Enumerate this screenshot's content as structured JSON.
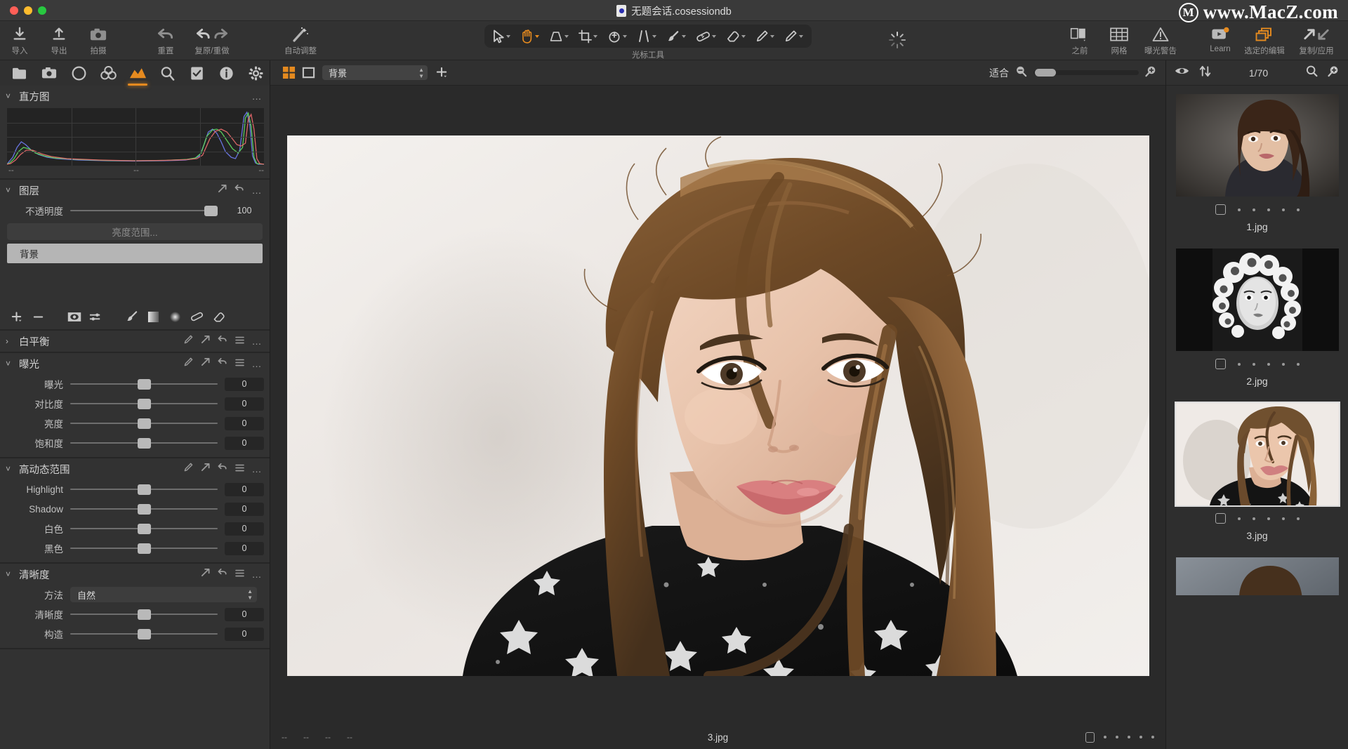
{
  "window": {
    "title": "无题会话.cosessiondb",
    "doc_icon": "session-document-icon",
    "watermark": "www.MacZ.com",
    "watermark_logo": "M"
  },
  "toolbar": {
    "left_items": [
      {
        "icon": "import-icon",
        "label": "导入"
      },
      {
        "icon": "export-icon",
        "label": "导出"
      },
      {
        "icon": "capture-icon",
        "label": "拍摄"
      }
    ],
    "history_items": [
      {
        "icon": "reset-icon",
        "label": "重置"
      },
      {
        "icon": "undo-redo-icon",
        "label": "复原/重做"
      }
    ],
    "auto_items": [
      {
        "icon": "magic-wand-icon",
        "label": "自动调整"
      }
    ],
    "cursor_tools_label": "光标工具",
    "cursor_tools": [
      {
        "icon": "pointer-icon",
        "name": "选择工具",
        "active": false
      },
      {
        "icon": "pan-hand-icon",
        "name": "平移工具",
        "active": true
      },
      {
        "icon": "keystone-icon",
        "name": "梯形校正",
        "active": false
      },
      {
        "icon": "crop-icon",
        "name": "裁剪工具",
        "active": false
      },
      {
        "icon": "rotate-icon",
        "name": "旋转工具",
        "active": false
      },
      {
        "icon": "straighten-icon",
        "name": "拉直工具",
        "active": false
      },
      {
        "icon": "brush-icon",
        "name": "绘制蒙版",
        "active": false
      },
      {
        "icon": "heal-icon",
        "name": "修复画笔",
        "active": false
      },
      {
        "icon": "eraser-icon",
        "name": "擦除工具",
        "active": false
      },
      {
        "icon": "pen-icon",
        "name": "钢笔工具",
        "active": false
      },
      {
        "icon": "draw-icon",
        "name": "绘图工具",
        "active": false
      }
    ],
    "spinner": "loading-spinner-icon",
    "right_items": [
      {
        "icon": "before-after-icon",
        "label": "之前"
      },
      {
        "icon": "grid-icon",
        "label": "网格"
      },
      {
        "icon": "exposure-warning-icon",
        "label": "曝光警告"
      },
      {
        "icon": "learn-play-icon",
        "label": "Learn"
      },
      {
        "icon": "selected-edits-icon",
        "label": "选定的编辑"
      },
      {
        "icon": "copy-apply-icon",
        "label": "复制/应用"
      }
    ]
  },
  "tool_tabs": [
    {
      "icon": "folder-icon",
      "name": "library-tab",
      "active": false
    },
    {
      "icon": "camera-icon",
      "name": "capture-tab",
      "active": false
    },
    {
      "icon": "lens-icon",
      "name": "lens-tab",
      "active": false
    },
    {
      "icon": "color-icon",
      "name": "color-tab",
      "active": false
    },
    {
      "icon": "exposure-icon",
      "name": "exposure-tab",
      "active": true
    },
    {
      "icon": "details-icon",
      "name": "details-tab",
      "active": false
    },
    {
      "icon": "adjust-icon",
      "name": "adjustments-tab",
      "active": false
    },
    {
      "icon": "metadata-icon",
      "name": "metadata-tab",
      "active": false
    },
    {
      "icon": "output-icon",
      "name": "output-tab",
      "active": false
    }
  ],
  "panels": {
    "histogram": {
      "title": "直方图",
      "menu": "…",
      "labels": [
        "--",
        "--",
        "--"
      ]
    },
    "layers": {
      "title": "图层",
      "opacity_label": "不透明度",
      "opacity_value": "100",
      "luma_range_button": "亮度范围...",
      "layer_name": "背景",
      "tools": [
        "add-layer-icon",
        "remove-layer-icon",
        "show-mask-icon",
        "invert-mask-icon",
        "brush-tool-icon",
        "gradient-mask-icon",
        "radial-mask-icon",
        "heal-layer-icon",
        "erase-layer-icon"
      ]
    },
    "white_balance": {
      "title": "白平衡",
      "collapsed": true
    },
    "exposure": {
      "title": "曝光",
      "rows": [
        {
          "label": "曝光",
          "value": "0"
        },
        {
          "label": "对比度",
          "value": "0"
        },
        {
          "label": "亮度",
          "value": "0"
        },
        {
          "label": "饱和度",
          "value": "0"
        }
      ]
    },
    "hdr": {
      "title": "高动态范围",
      "rows": [
        {
          "label": "Highlight",
          "value": "0"
        },
        {
          "label": "Shadow",
          "value": "0"
        },
        {
          "label": "白色",
          "value": "0"
        },
        {
          "label": "黑色",
          "value": "0"
        }
      ]
    },
    "clarity": {
      "title": "清晰度",
      "method_label": "方法",
      "method_value": "自然",
      "rows": [
        {
          "label": "清晰度",
          "value": "0"
        },
        {
          "label": "构造",
          "value": "0"
        }
      ]
    },
    "panel_icons": [
      "picker-icon",
      "reset-arrow-icon",
      "undo-arrow-icon",
      "menu-lines-icon",
      "more-dots-icon"
    ]
  },
  "viewer": {
    "bar": {
      "multi_view_icon": "multi-view-icon",
      "single_view_icon": "single-view-icon",
      "variant_value": "背景",
      "add_variant_icon": "add-variant-icon",
      "fit_label": "适合",
      "zoom_out_icon": "zoom-out-icon",
      "zoom_in_icon": "zoom-in-icon"
    },
    "footer": {
      "dashes": [
        "--",
        "--",
        "--",
        "--"
      ],
      "filename": "3.jpg",
      "rating_dots": 5
    }
  },
  "browser": {
    "bar": {
      "visibility_icon": "eye-icon",
      "sort_icon": "sort-updown-icon",
      "count": "1/70",
      "search_icon": "search-icon",
      "zoom_icon": "thumb-zoom-icon"
    },
    "thumbnails": [
      {
        "name": "1.jpg",
        "selected": false,
        "rating_dots": 5,
        "art": "portrait-brunette"
      },
      {
        "name": "2.jpg",
        "selected": false,
        "rating_dots": 5,
        "art": "portrait-bw-curly"
      },
      {
        "name": "3.jpg",
        "selected": true,
        "rating_dots": 5,
        "art": "portrait-main"
      },
      {
        "name": "",
        "selected": false,
        "rating_dots": 0,
        "art": "portrait-partial"
      }
    ]
  },
  "colors": {
    "accent": "#e58a1f",
    "panel_bg": "#323232",
    "viewer_bg": "#2a2a2a",
    "text": "#d2d2d2"
  }
}
